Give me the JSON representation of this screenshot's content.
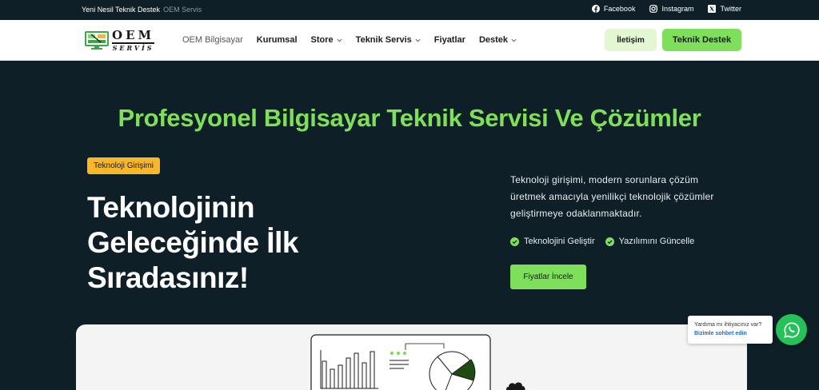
{
  "topbar": {
    "tagline": "Yeni Nesil Teknik Destek",
    "site_name": "OEM Servis",
    "social": [
      {
        "label": "Facebook",
        "icon": "facebook-icon"
      },
      {
        "label": "Instagram",
        "icon": "instagram-icon"
      },
      {
        "label": "Twitter",
        "icon": "x-twitter-icon"
      }
    ]
  },
  "header": {
    "logo": {
      "brand": "OEM",
      "sub": "SERVİS"
    },
    "nav": [
      {
        "label": "OEM Bilgisayar",
        "dropdown": false
      },
      {
        "label": "Kurumsal",
        "dropdown": false
      },
      {
        "label": "Store",
        "dropdown": true
      },
      {
        "label": "Teknik Servis",
        "dropdown": true
      },
      {
        "label": "Fiyatlar",
        "dropdown": false
      },
      {
        "label": "Destek",
        "dropdown": true
      }
    ],
    "contact_label": "İletişim",
    "support_label": "Teknik Destek"
  },
  "hero": {
    "title": "Profesyonel Bilgisayar Teknik Servisi Ve Çözümler",
    "badge": "Teknoloji Girişimi",
    "headline": "Teknolojinin Geleceğinde İlk Sıradasınız!",
    "description": "Teknoloji girişimi, modern sorunlara çözüm üretmek amacıyla yenilikçi teknolojik çözümler geliştirmeye odaklanmaktadır.",
    "checks": [
      "Teknolojini Geliştir",
      "Yazılımını Güncelle"
    ],
    "cta_label": "Fiyatlar İncele"
  },
  "chat": {
    "prompt": "Yardıma mı ihtiyacınız var?",
    "link": "Bizimle sohbet edin"
  },
  "colors": {
    "accent_green": "#7ee05a",
    "dark_bg": "#0f1f27",
    "badge_yellow": "#f6b72b",
    "whatsapp_green": "#25c25a"
  }
}
